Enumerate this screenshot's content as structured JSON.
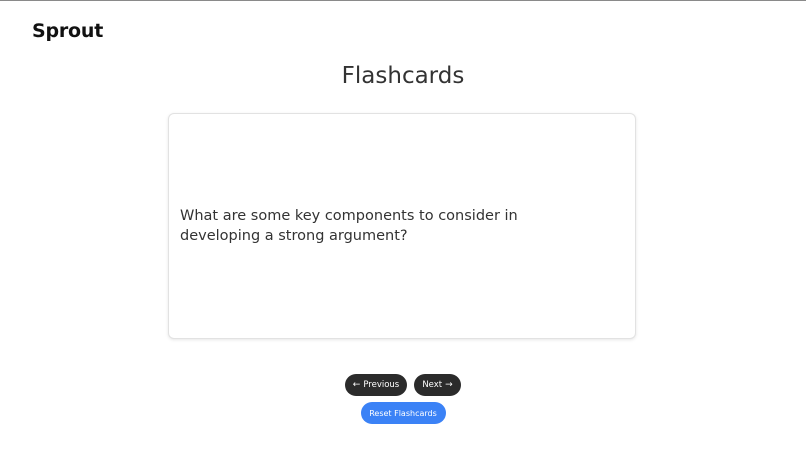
{
  "app": {
    "logo": "Sprout"
  },
  "page": {
    "title": "Flashcards"
  },
  "card": {
    "text": "What are some key components to consider in developing a strong argument?"
  },
  "controls": {
    "previous_arrow": "←",
    "previous_label": "Previous",
    "next_label": "Next",
    "next_arrow": "→",
    "reset_label": "Reset Flashcards"
  },
  "colors": {
    "dark_button": "#2b2b2b",
    "accent": "#3b82f6",
    "text": "#333333"
  },
  "icons": {
    "previous": "arrow-left-icon",
    "next": "arrow-right-icon"
  }
}
